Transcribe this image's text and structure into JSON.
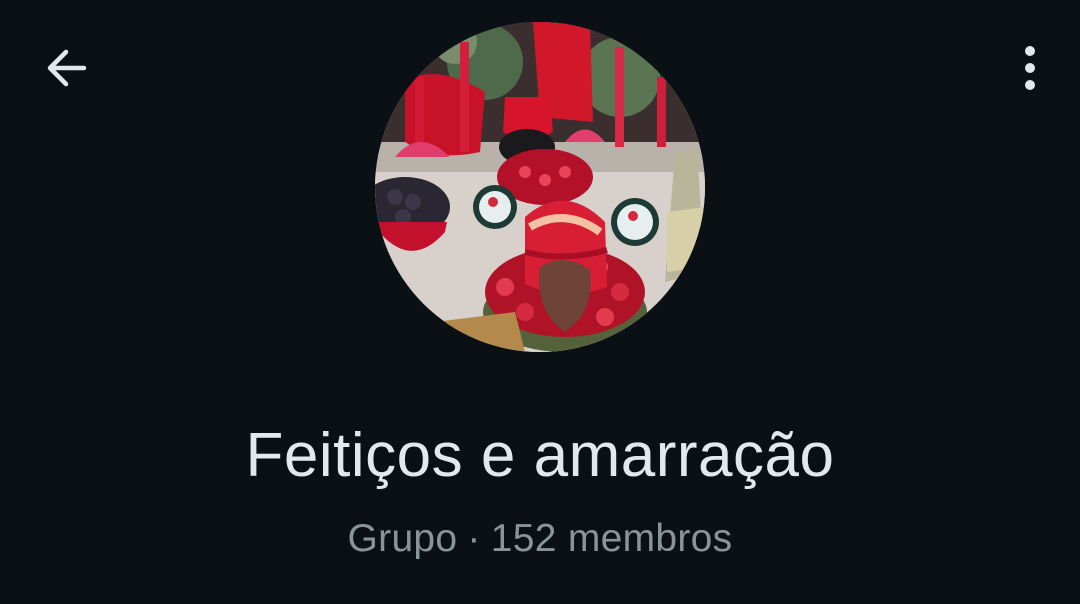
{
  "header": {
    "back_icon": "arrow-left-icon",
    "more_icon": "more-vertical-icon"
  },
  "profile": {
    "avatar_description": "group-photo",
    "name": "Feitiços e amarração",
    "type": "Grupo",
    "separator": "·",
    "members": "152 membros"
  },
  "colors": {
    "background": "#0b1014",
    "name_text": "#e4e8ea",
    "meta_text": "#8a9499",
    "icon": "#e4e8ea"
  }
}
